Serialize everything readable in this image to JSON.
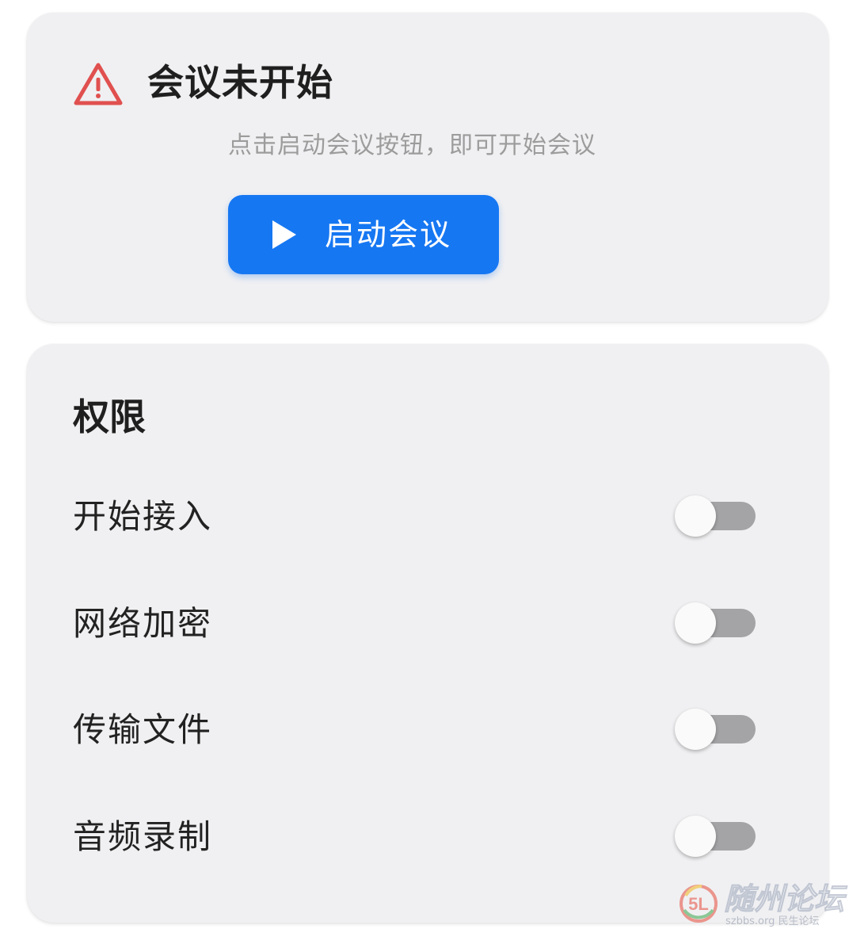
{
  "meeting": {
    "title": "会议未开始",
    "hint": "点击启动会议按钮，即可开始会议",
    "start_button_label": "启动会议",
    "warning_icon": "warning-triangle-icon",
    "play_icon": "play-icon",
    "accent_color": "#1677f2",
    "warning_color": "#e0504f"
  },
  "permissions": {
    "title": "权限",
    "items": [
      {
        "label": "开始接入",
        "enabled": false
      },
      {
        "label": "网络加密",
        "enabled": false
      },
      {
        "label": "传输文件",
        "enabled": false
      },
      {
        "label": "音频录制",
        "enabled": false
      }
    ]
  },
  "watermark": {
    "text": "随州论坛",
    "sub": "szbbs.org 民生论坛"
  }
}
